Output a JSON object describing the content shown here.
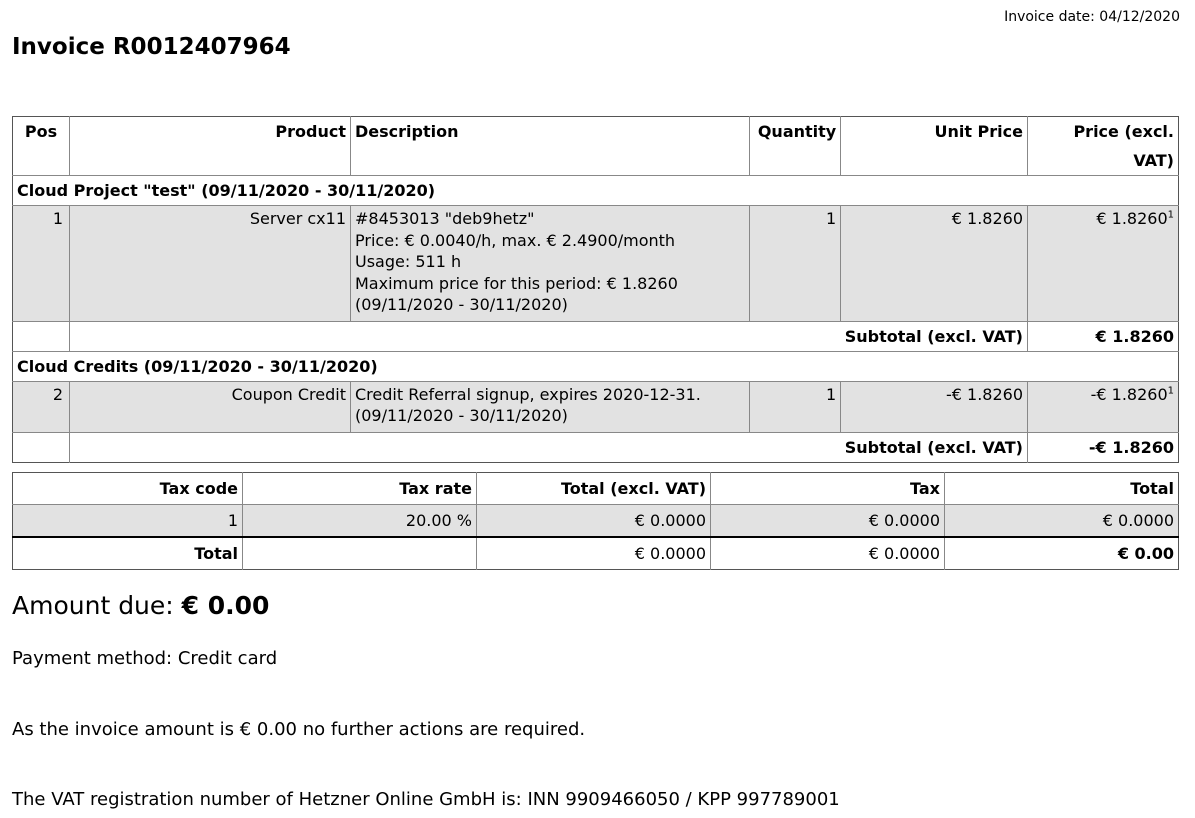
{
  "invoice_date": "Invoice date: 04/12/2020",
  "title": "Invoice R0012407964",
  "main_table": {
    "headers": {
      "pos": "Pos",
      "product": "Product",
      "description": "Description",
      "quantity": "Quantity",
      "unit_price": "Unit Price",
      "price": "Price (excl. VAT)"
    },
    "groups": [
      {
        "heading": "Cloud Project \"test\" (09/11/2020 - 30/11/2020)",
        "item": {
          "pos": "1",
          "product": "Server cx11",
          "description": [
            "#8453013 \"deb9hetz\"",
            "Price: € 0.0040/h, max. € 2.4900/month",
            "Usage: 511 h",
            "Maximum price for this period: € 1.8260",
            "(09/11/2020 - 30/11/2020)"
          ],
          "quantity": "1",
          "unit_price": "€ 1.8260",
          "price": "€ 1.8260",
          "price_footnote": "1"
        },
        "subtotal_label": "Subtotal (excl. VAT)",
        "subtotal_value": "€ 1.8260"
      },
      {
        "heading": "Cloud Credits (09/11/2020 - 30/11/2020)",
        "item": {
          "pos": "2",
          "product": "Coupon Credit",
          "description": [
            "Credit Referral signup, expires 2020-12-31.",
            "(09/11/2020 - 30/11/2020)"
          ],
          "quantity": "1",
          "unit_price": "-€ 1.8260",
          "price": "-€ 1.8260",
          "price_footnote": "1"
        },
        "subtotal_label": "Subtotal (excl. VAT)",
        "subtotal_value": "-€ 1.8260"
      }
    ]
  },
  "tax_table": {
    "headers": {
      "tax_code": "Tax code",
      "tax_rate": "Tax rate",
      "total_excl": "Total (excl. VAT)",
      "tax": "Tax",
      "total": "Total"
    },
    "row": {
      "tax_code": "1",
      "tax_rate": "20.00 %",
      "total_excl": "€ 0.0000",
      "tax": "€ 0.0000",
      "total": "€ 0.0000"
    },
    "total_row": {
      "label": "Total",
      "total_excl": "€ 0.0000",
      "tax": "€ 0.0000",
      "total": "€ 0.00"
    }
  },
  "amount_due": {
    "label": "Amount due:",
    "value": "€ 0.00"
  },
  "payment_method": "Payment method: Credit card",
  "note": "As the invoice amount is € 0.00 no further actions are required.",
  "vat_note": "The VAT registration number of Hetzner Online GmbH is: INN 9909466050 / KPP 997789001"
}
